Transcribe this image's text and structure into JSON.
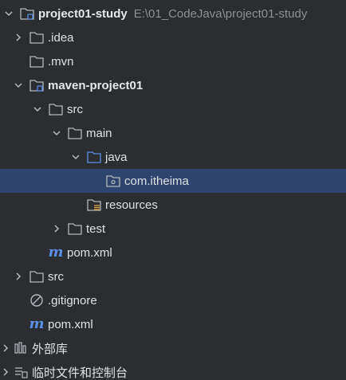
{
  "tree": {
    "root": {
      "label": "project01-study",
      "path": "E:\\01_CodeJava\\project01-study"
    },
    "idea": {
      "label": ".idea"
    },
    "mvn": {
      "label": ".mvn"
    },
    "module": {
      "label": "maven-project01"
    },
    "module_src": {
      "label": "src"
    },
    "main": {
      "label": "main"
    },
    "java": {
      "label": "java"
    },
    "package": {
      "label": "com.itheima"
    },
    "resources": {
      "label": "resources"
    },
    "test": {
      "label": "test"
    },
    "module_pom": {
      "label": "pom.xml"
    },
    "root_src": {
      "label": "src"
    },
    "gitignore": {
      "label": ".gitignore"
    },
    "root_pom": {
      "label": "pom.xml"
    },
    "external_libs": {
      "label": "外部库"
    },
    "scratches": {
      "label": "临时文件和控制台"
    }
  },
  "colors": {
    "background": "#2b2d30",
    "selection": "#2e436e",
    "text": "#dfe1e5",
    "path_text": "#8c8f94",
    "maven_icon": "#5c8fe6",
    "source_folder": "#5c8fe6"
  }
}
